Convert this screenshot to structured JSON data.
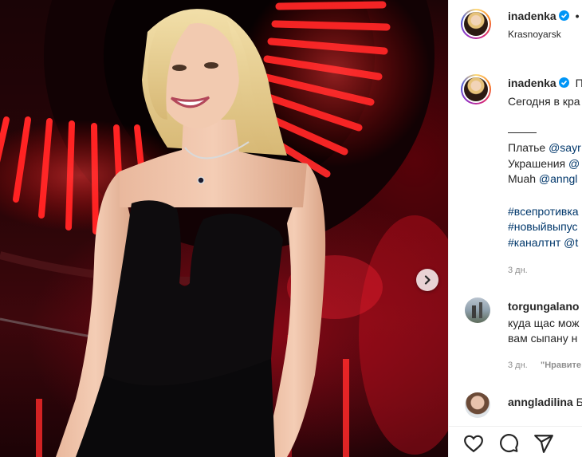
{
  "post": {
    "username": "inadenka",
    "dot": "•",
    "location": "Krasnoyarsk"
  },
  "caption": {
    "username": "inadenka",
    "line1_start": "П",
    "line2": "Сегодня в кра",
    "dress_label": "Платье ",
    "dress_link": "@sayr",
    "jewelry_label": "Украшения ",
    "jewelry_link": "@",
    "muah_label": "Muah ",
    "muah_link": "@anngl",
    "hashtag1": "#всепротивка",
    "hashtag2": "#новыйвыпус",
    "hashtag3": "#каналтнт",
    "hashtag3_extra": " @t",
    "time": "3 дн."
  },
  "comments": [
    {
      "username": "torgungalano",
      "line1": "куда щас мож",
      "line2": "вам сыпану н",
      "time": "3 дн.",
      "like_text": "\"Нравите"
    },
    {
      "username": "anngladilina",
      "line1_tail": " Б"
    }
  ],
  "icons": [
    "heart-icon",
    "comment-icon",
    "share-icon",
    "verified-icon",
    "chevron-right-icon"
  ],
  "colors": {
    "link": "#00376b",
    "verified": "#0095f6",
    "text": "#262626",
    "muted": "#8e8e8e",
    "neon": "#ff2a2a"
  }
}
